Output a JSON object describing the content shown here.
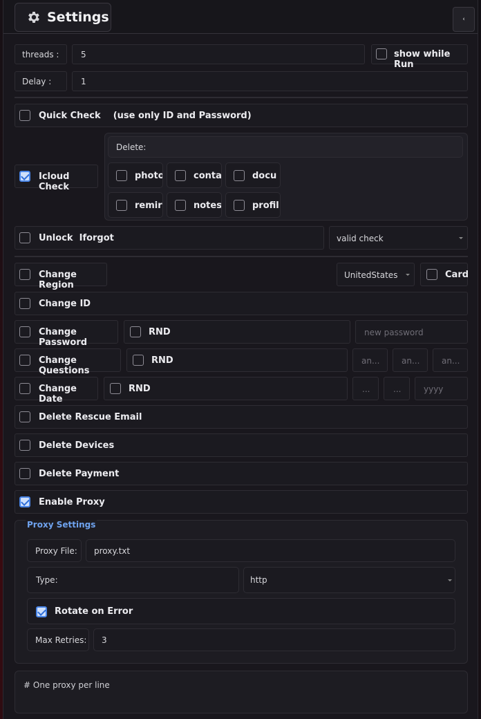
{
  "header": {
    "title": "Settings"
  },
  "threads": {
    "label": "threads  :",
    "value": "5"
  },
  "show_while_run": {
    "label": "show while Run",
    "checked": false
  },
  "delay": {
    "label": "Delay    :",
    "value": "1"
  },
  "quick_check": {
    "label": "Quick Check    (use only ID and Password)",
    "checked": false
  },
  "icloud_check": {
    "label": "Icloud Check",
    "checked": true,
    "delete_label": "Delete:",
    "items": [
      {
        "label": "photo",
        "checked": false
      },
      {
        "label": "conta",
        "checked": false
      },
      {
        "label": "docu",
        "checked": false
      },
      {
        "label": "remir",
        "checked": false
      },
      {
        "label": "notes",
        "checked": false
      },
      {
        "label": "profil",
        "checked": false
      }
    ]
  },
  "unlock_iforgot": {
    "label": "Unlock  Iforgot",
    "checked": false,
    "select": "valid check"
  },
  "change_region": {
    "label": "Change Region",
    "checked": false,
    "select": "UnitedStates",
    "card_label": "Card",
    "card_checked": false
  },
  "change_id": {
    "label": "Change ID",
    "checked": false
  },
  "change_password": {
    "label": "Change Password",
    "checked": false,
    "rnd": "RND",
    "placeholder": "new password"
  },
  "change_questions": {
    "label": "Change Questions",
    "checked": false,
    "rnd": "RND",
    "placeholders": [
      "an...",
      "an...",
      "an..."
    ]
  },
  "change_date": {
    "label": "Change Date",
    "checked": false,
    "rnd": "RND",
    "placeholders": [
      "...",
      "...",
      "yyyy"
    ]
  },
  "delete_rescue": {
    "label": "Delete Rescue Email",
    "checked": false
  },
  "delete_devices": {
    "label": "Delete Devices",
    "checked": false
  },
  "delete_payment": {
    "label": "Delete Payment",
    "checked": false
  },
  "enable_proxy": {
    "label": "Enable Proxy",
    "checked": true
  },
  "proxy": {
    "group_title": "Proxy Settings",
    "file_label": "Proxy File:",
    "file_value": "proxy.txt",
    "type_label": "Type:",
    "type_value": "http",
    "rotate_label": "Rotate on Error",
    "rotate_checked": true,
    "retries_label": "Max Retries:",
    "retries_value": "3",
    "list_placeholder": "# One proxy per line"
  },
  "colors": {
    "accent": "#4a86e8",
    "group_title": "#6fa3ef",
    "panel": "#19171d"
  }
}
